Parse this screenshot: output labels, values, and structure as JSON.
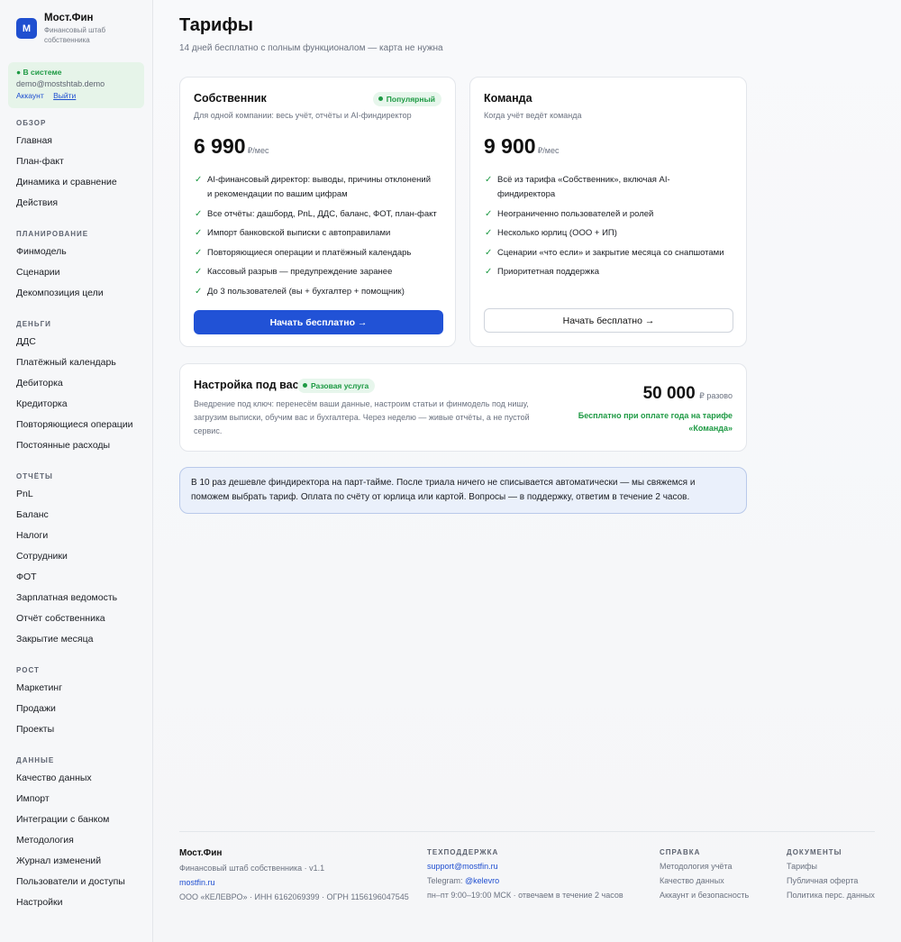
{
  "brand": {
    "logo_letter": "М",
    "name": "Мост.Фин",
    "subtitle": "Финансовый штаб собственника"
  },
  "session": {
    "status": "● В системе",
    "email": "demo@mostshtab.demo",
    "account_link": "Аккаунт",
    "logout_link": "Выйти"
  },
  "sidebar": {
    "groups": [
      {
        "heading": "ОБЗОР",
        "items": [
          "Главная",
          "План-факт",
          "Динамика и сравнение",
          "Действия"
        ]
      },
      {
        "heading": "ПЛАНИРОВАНИЕ",
        "items": [
          "Финмодель",
          "Сценарии",
          "Декомпозиция цели"
        ]
      },
      {
        "heading": "ДЕНЬГИ",
        "items": [
          "ДДС",
          "Платёжный календарь",
          "Дебиторка",
          "Кредиторка",
          "Повторяющиеся операции",
          "Постоянные расходы"
        ]
      },
      {
        "heading": "ОТЧЁТЫ",
        "items": [
          "PnL",
          "Баланс",
          "Налоги",
          "Сотрудники",
          "ФОТ",
          "Зарплатная ведомость",
          "Отчёт собственника",
          "Закрытие месяца"
        ]
      },
      {
        "heading": "РОСТ",
        "items": [
          "Маркетинг",
          "Продажи",
          "Проекты"
        ]
      },
      {
        "heading": "ДАННЫЕ",
        "items": [
          "Качество данных",
          "Импорт",
          "Интеграции с банком",
          "Методология",
          "Журнал изменений",
          "Пользователи и доступы",
          "Настройки"
        ]
      }
    ]
  },
  "page": {
    "title": "Тарифы",
    "subtitle": "14 дней бесплатно с полным функционалом — карта не нужна"
  },
  "plans": [
    {
      "title": "Собственник",
      "badge": "Популярный",
      "description": "Для одной компании: весь учёт, отчёты и AI-финдиректор",
      "price": "6 990",
      "unit": "₽/мес",
      "features": [
        "AI-финансовый директор: выводы, причины отклонений и рекомендации по вашим цифрам",
        "Все отчёты: дашборд, PnL, ДДС, баланс, ФОТ, план-факт",
        "Импорт банковской выписки с автоправилами",
        "Повторяющиеся операции и платёжный календарь",
        "Кассовый разрыв — предупреждение заранее",
        "До 3 пользователей (вы + бухгалтер + помощник)"
      ],
      "button": "Начать бесплатно →"
    },
    {
      "title": "Команда",
      "description": "Когда учёт ведёт команда",
      "price": "9 900",
      "unit": "₽/мес",
      "features": [
        "Всё из тарифа «Собственник», включая AI-финдиректора",
        "Неограниченно пользователей и ролей",
        "Несколько юрлиц (ООО + ИП)",
        "Сценарии «что если» и закрытие месяца со снапшотами",
        "Приоритетная поддержка"
      ],
      "button": "Начать бесплатно →"
    }
  ],
  "custom": {
    "title": "Настройка под вас",
    "badge": "Разовая услуга",
    "description": "Внедрение под ключ: перенесём ваши данные, настроим статьи и финмодель под нишу, загрузим выписки, обучим вас и бухгалтера. Через неделю — живые отчёты, а не пустой сервис.",
    "price": "50 000",
    "unit": "₽ разово",
    "note": "Бесплатно при оплате года на тарифе «Команда»"
  },
  "info": "В 10 раз дешевле финдиректора на парт-тайме. После триала ничего не списывается автоматически — мы свяжемся и поможем выбрать тариф. Оплата по счёту от юрлица или картой. Вопросы — в поддержку, ответим в течение 2 часов.",
  "footer": {
    "company": {
      "name": "Мост.Фин",
      "tagline": "Финансовый штаб собственника · v1.1",
      "site": "mostfin.ru",
      "legal": "ООО «КЕЛЕВРО» · ИНН 6162069399 · ОГРН 1156196047545"
    },
    "support": {
      "heading": "ТЕХПОДДЕРЖКА",
      "email": "support@mostfin.ru",
      "telegram_label": "Telegram:",
      "telegram": "@kelevro",
      "hours": "пн–пт 9:00–19:00 МСК · отвечаем в течение 2 часов"
    },
    "help": {
      "heading": "СПРАВКА",
      "items": [
        "Методология учёта",
        "Качество данных",
        "Аккаунт и безопасность"
      ]
    },
    "docs": {
      "heading": "ДОКУМЕНТЫ",
      "items": [
        "Тарифы",
        "Публичная оферта",
        "Политика перс. данных"
      ]
    }
  },
  "colors": {
    "accent": "#2152d6",
    "success": "#1e9a44",
    "info_bg": "#eaf0fb"
  }
}
